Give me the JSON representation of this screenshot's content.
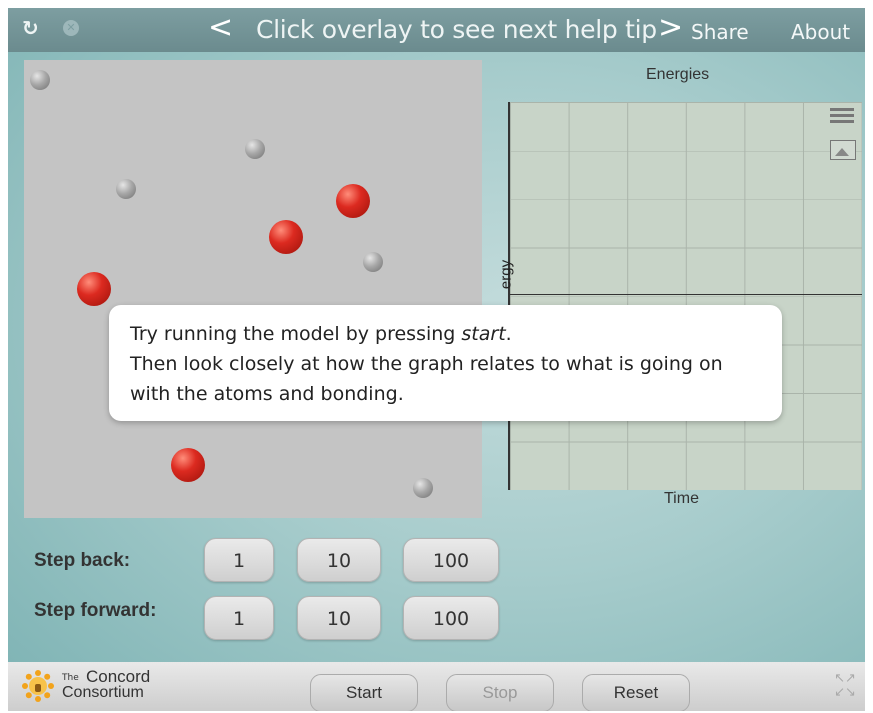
{
  "topbar": {
    "reload_icon": "reload-icon",
    "close_icon": "close-icon",
    "prev_tip": "<",
    "next_tip": ">",
    "tip_title": "Click overlay to see next help tip",
    "share": "Share",
    "about": "About"
  },
  "model": {
    "small_atom_color": "#a8a8a8",
    "big_atom_color": "#dc2a20"
  },
  "graph": {
    "title": "Energies",
    "ylabel": "ergy",
    "xlabel": "Time",
    "legend_icon": "list-icon",
    "snapshot_icon": "image-icon"
  },
  "help_tip": {
    "line1_prefix": "Try running the model by pressing ",
    "line1_emph": "start",
    "line1_suffix": ".",
    "line2": "Then look closely at how the graph relates to what is going on",
    "line3": "with the atoms and bonding."
  },
  "step_back": {
    "label": "Step back:",
    "buttons": [
      "1",
      "10",
      "100"
    ]
  },
  "step_forward": {
    "label": "Step forward:",
    "buttons": [
      "1",
      "10",
      "100"
    ]
  },
  "bottom": {
    "logo_the": "The",
    "logo_concord": "Concord",
    "logo_consortium": "Consortium",
    "start": "Start",
    "stop": "Stop",
    "reset": "Reset",
    "fullscreen_icon": "fullscreen-icon"
  }
}
